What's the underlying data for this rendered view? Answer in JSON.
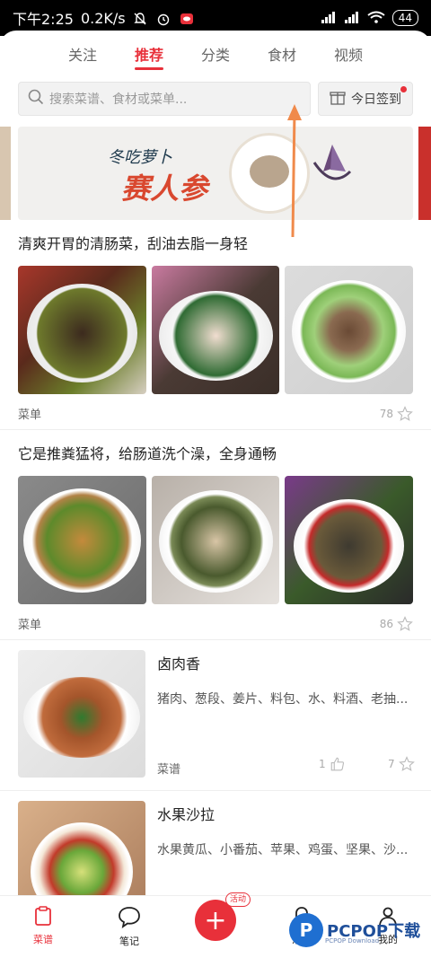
{
  "status_bar": {
    "time": "下午2:25",
    "speed": "0.2K/s",
    "battery": "44"
  },
  "tabs": [
    {
      "label": "关注"
    },
    {
      "label": "推荐"
    },
    {
      "label": "分类"
    },
    {
      "label": "食材"
    },
    {
      "label": "视频"
    }
  ],
  "search": {
    "placeholder": "搜索菜谱、食材或菜单..."
  },
  "checkin": {
    "label": "今日签到"
  },
  "banner": {
    "line1": "冬吃萝卜",
    "line2": "赛人参"
  },
  "sections": [
    {
      "title": "清爽开胃的清肠菜，刮油去脂一身轻",
      "type_label": "菜单",
      "count": "78"
    },
    {
      "title": "它是推粪猛将，给肠道洗个澡，全身通畅",
      "type_label": "菜单",
      "count": "86"
    }
  ],
  "recipes": [
    {
      "name": "卤肉香",
      "ingredients": "猪肉、葱段、姜片、料包、水、料酒、老抽...",
      "type_label": "菜谱",
      "likes": "1",
      "favorites": "7"
    },
    {
      "name": "水果沙拉",
      "ingredients": "水果黄瓜、小番茄、苹果、鸡蛋、坚果、沙..."
    }
  ],
  "bottom_nav": {
    "recipes": "菜谱",
    "notes": "笔记",
    "plus_badge": "活动",
    "messages": "消息",
    "mine": "我的"
  },
  "watermark": {
    "brand": "PCPOP下载",
    "sub": "PCPOP Download"
  },
  "colors": {
    "accent": "#e8303a"
  }
}
